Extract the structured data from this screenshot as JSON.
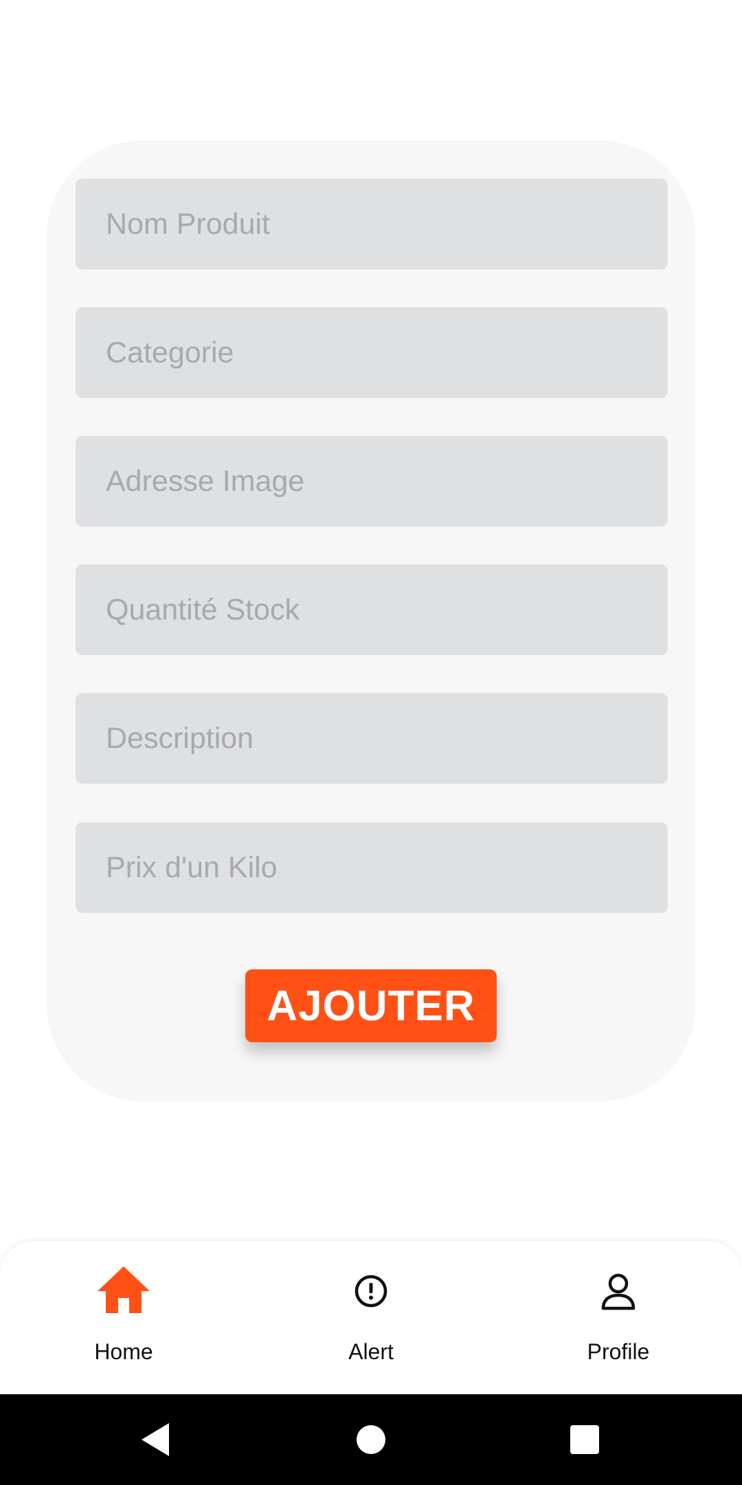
{
  "form": {
    "fields": [
      {
        "placeholder": "Nom Produit",
        "value": ""
      },
      {
        "placeholder": "Categorie",
        "value": ""
      },
      {
        "placeholder": "Adresse Image",
        "value": ""
      },
      {
        "placeholder": "Quantité Stock",
        "value": ""
      },
      {
        "placeholder": "Description",
        "value": ""
      },
      {
        "placeholder": "Prix d'un Kilo",
        "value": ""
      }
    ],
    "submit_label": "AJOUTER"
  },
  "bottom_nav": {
    "items": [
      {
        "label": "Home",
        "icon": "home-icon",
        "active": true
      },
      {
        "label": "Alert",
        "icon": "alert-circle-icon",
        "active": false
      },
      {
        "label": "Profile",
        "icon": "person-icon",
        "active": false
      }
    ]
  },
  "system_nav": {
    "buttons": [
      "back-icon",
      "home-circle-icon",
      "recents-icon"
    ]
  },
  "colors": {
    "accent": "#ff5116",
    "card_bg": "#f7f7f7",
    "field_bg": "#dfe0e2",
    "placeholder": "#a8a9ab",
    "nav_text": "#111111",
    "system_bar": "#000000"
  }
}
